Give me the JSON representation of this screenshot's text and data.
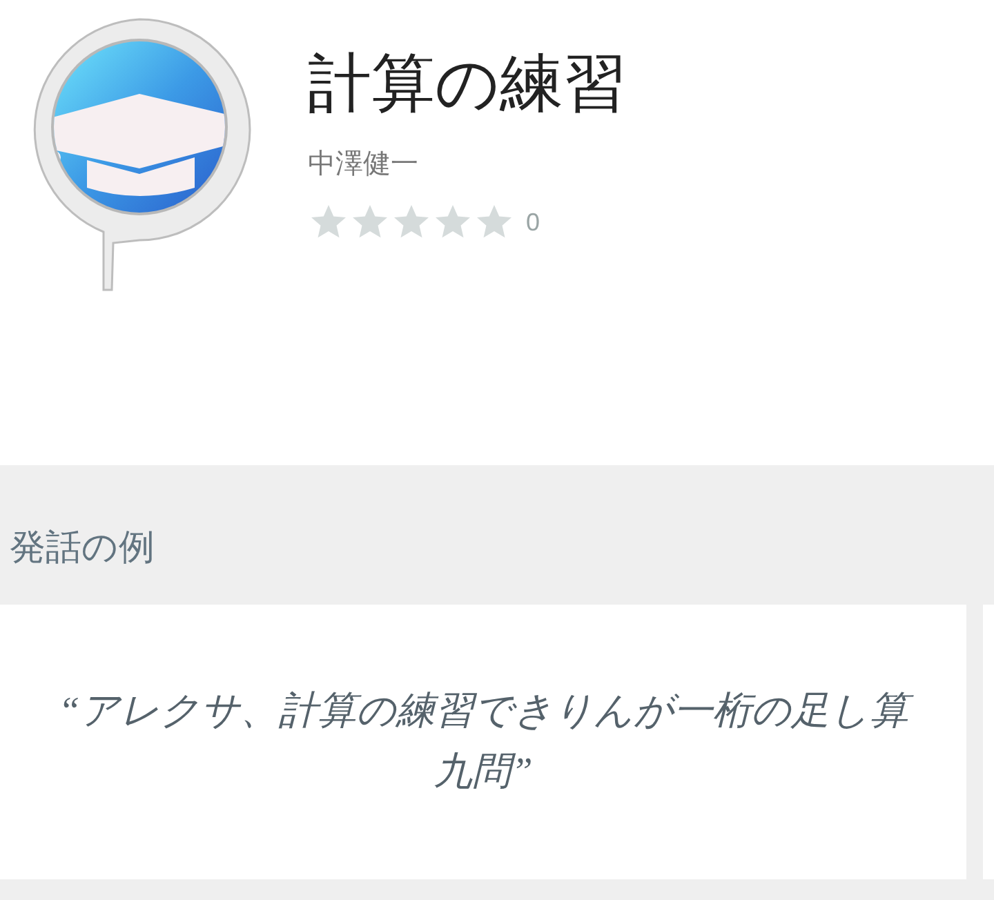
{
  "skill": {
    "title": "計算の練習",
    "author": "中澤健一",
    "stars": 0,
    "rating_count": "0"
  },
  "examples": {
    "heading": "発話の例",
    "items": [
      {
        "text": "“アレクサ、計算の練習できりんが一桁の足し算九問”"
      }
    ]
  }
}
